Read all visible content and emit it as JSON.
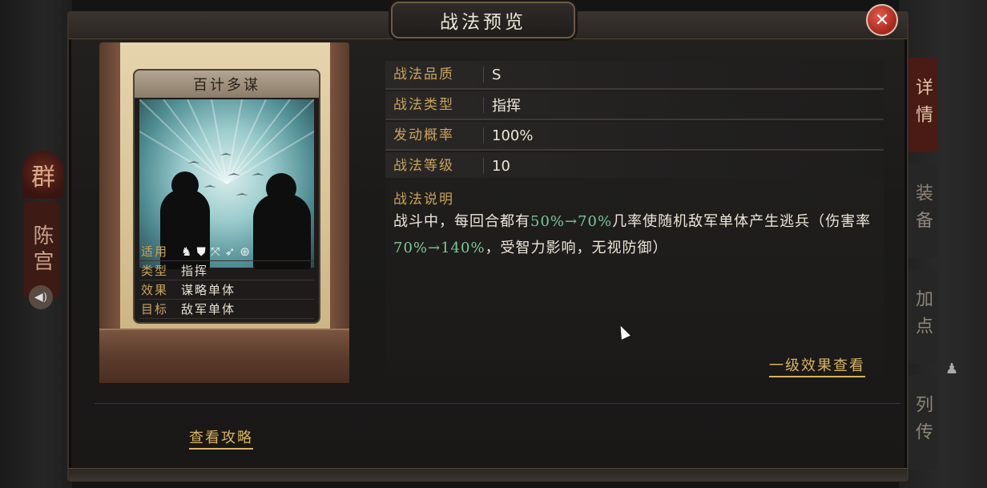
{
  "dialog": {
    "title": "战法预览",
    "close_label": "✕"
  },
  "hero": {
    "faction": "群",
    "name": "陈宫"
  },
  "tabs": [
    {
      "label": "详情",
      "active": true
    },
    {
      "label": "装备",
      "active": false
    },
    {
      "label": "加点",
      "active": false
    },
    {
      "label": "列传",
      "active": false
    }
  ],
  "card": {
    "name": "百计多谋",
    "stats": [
      {
        "key": "适用",
        "value": ""
      },
      {
        "key": "类型",
        "value": "指挥"
      },
      {
        "key": "效果",
        "value": "谋略单体"
      },
      {
        "key": "目标",
        "value": "敌军单体"
      }
    ],
    "troop_icons": [
      "cavalry-icon",
      "shield-icon",
      "bow-icon",
      "spear-icon",
      "siege-icon"
    ]
  },
  "info": [
    {
      "key": "战法品质",
      "value": "S"
    },
    {
      "key": "战法类型",
      "value": "指挥"
    },
    {
      "key": "发动概率",
      "value": "100%"
    },
    {
      "key": "战法等级",
      "value": "10"
    }
  ],
  "description": {
    "title": "战法说明",
    "parts": [
      "战斗中，每回合都有",
      "50%→70%",
      "几率使随机敌军单体产生逃兵（伤害率",
      "70%→140%",
      "，受智力影响，无视防御）"
    ]
  },
  "links": {
    "level_one": "一级效果查看",
    "guide": "查看攻略"
  },
  "colors": {
    "gold": "#c9a35c",
    "highlight": "#7cc79a",
    "close": "#a3271b"
  }
}
